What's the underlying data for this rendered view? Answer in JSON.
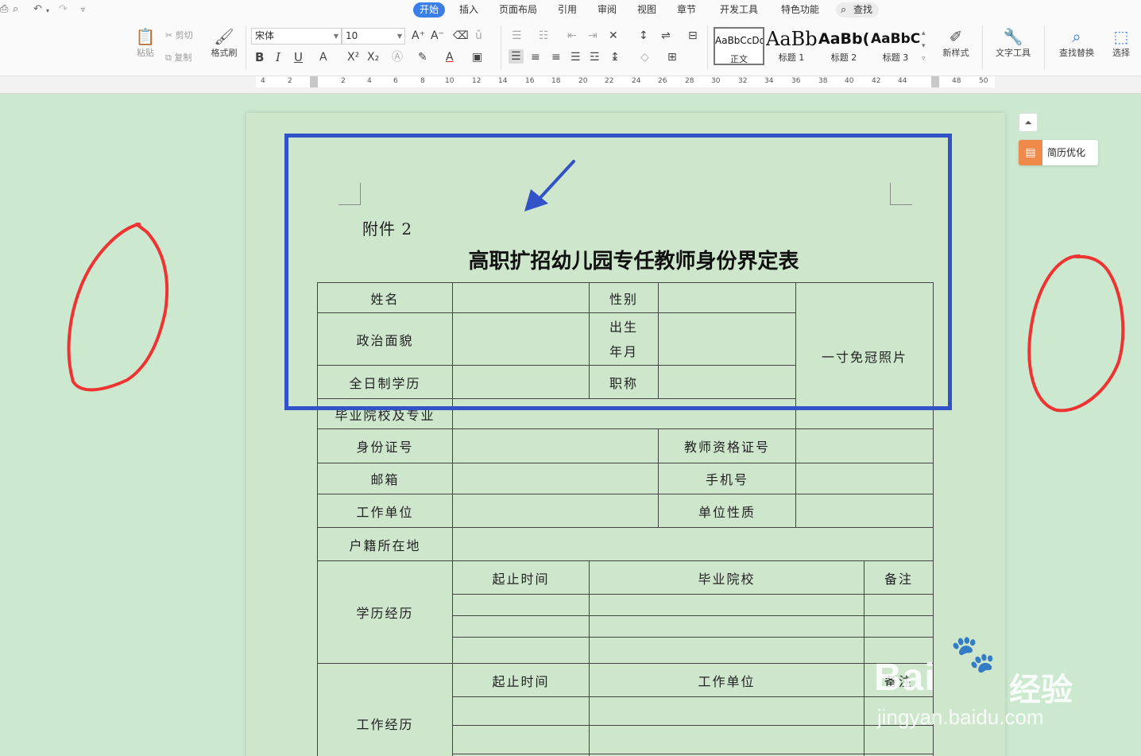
{
  "tabs": [
    "开始",
    "插入",
    "页面布局",
    "引用",
    "审阅",
    "视图",
    "章节",
    "开发工具",
    "特色功能"
  ],
  "search_label": "查找",
  "ribbon": {
    "paste": "粘贴",
    "cut": "剪切",
    "copy": "复制",
    "format_painter": "格式刷",
    "font_name": "宋体",
    "font_size": "10",
    "styles": [
      {
        "preview": "AaBbCcDd",
        "name": "正文"
      },
      {
        "preview": "AaBb",
        "name": "标题 1"
      },
      {
        "preview": "AaBb(",
        "name": "标题 2"
      },
      {
        "preview": "AaBbC",
        "name": "标题 3"
      }
    ],
    "new_style": "新样式",
    "text_tools": "文字工具",
    "find_replace": "查找替换",
    "select": "选择"
  },
  "ruler_labels": [
    "4",
    "2",
    "2",
    "4",
    "6",
    "8",
    "10",
    "12",
    "14",
    "16",
    "18",
    "20",
    "22",
    "24",
    "26",
    "28",
    "30",
    "32",
    "34",
    "36",
    "38",
    "40",
    "42",
    "44",
    "48",
    "50"
  ],
  "side_panel": {
    "collapse_icon": "⏶",
    "resume_optimize": "简历优化"
  },
  "document": {
    "attachment": "附件 2",
    "title": "高职扩招幼儿园专任教师身份界定表",
    "labels": {
      "name": "姓名",
      "gender": "性别",
      "political_status": "政治面貌",
      "birth_1": "出生",
      "birth_2": "年月",
      "photo": "一寸免冠照片",
      "education": "全日制学历",
      "title": "职称",
      "school_major": "毕业院校及专业",
      "id_number": "身份证号",
      "teacher_cert": "教师资格证号",
      "email": "邮箱",
      "phone": "手机号",
      "work_unit": "工作单位",
      "unit_type": "单位性质",
      "household": "户籍所在地",
      "edu_history": "学历经历",
      "period": "起止时间",
      "graduate_school": "毕业院校",
      "remark": "备注",
      "work_history": "工作经历",
      "period2": "起止时间",
      "work_unit2": "工作单位",
      "remark2": "备注"
    }
  },
  "watermark": {
    "brand": "Bai",
    "suffix": "经验",
    "url": "jingyan.baidu.com"
  },
  "annotation_colors": {
    "box": "#3253c7",
    "arrow": "#3253c7",
    "circles": "#ee3333"
  }
}
